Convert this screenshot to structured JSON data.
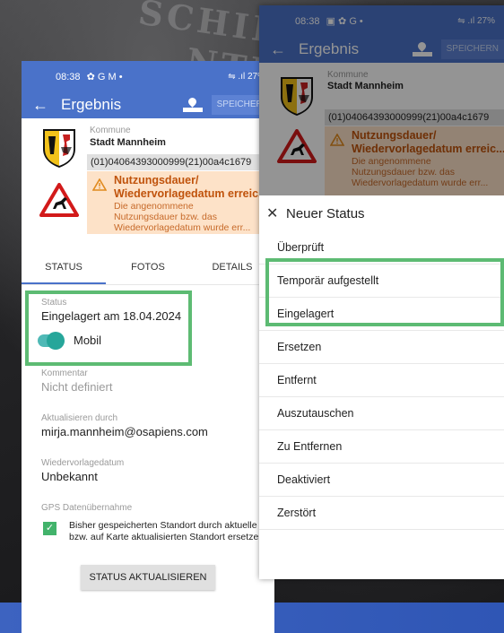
{
  "background": {
    "engraved_text": [
      "SCHILDERWE",
      "NTHA GR"
    ]
  },
  "left_phone": {
    "status_bar": {
      "time": "08:38",
      "icons": "✿ G M •",
      "battery": "27%"
    },
    "app_bar": {
      "title": "Ergebnis",
      "save_label": "SPEICHERN"
    },
    "object": {
      "kommune_label": "Kommune",
      "kommune_value": "Stadt Mannheim",
      "code": "(01)04064393000999(21)00a4c1679",
      "warning_title_1": "Nutzungsdauer/",
      "warning_title_2": "Wiedervorlagedatum erreic...",
      "warning_text_1": "Die angenommene",
      "warning_text_2": "Nutzungsdauer bzw. das",
      "warning_text_3": "Wiedervorlagedatum wurde err..."
    },
    "tabs": [
      "STATUS",
      "FOTOS",
      "DETAILS"
    ],
    "status": {
      "label": "Status",
      "value": "Eingelagert am 18.04.2024",
      "toggle_label": "Mobil",
      "toggle_on": true
    },
    "kommentar": {
      "label": "Kommentar",
      "value": "Nicht definiert"
    },
    "aktualisiert": {
      "label": "Aktualisieren durch",
      "value": "mirja.mannheim@osapiens.com"
    },
    "wiedervorlage": {
      "label": "Wiedervorlagedatum",
      "value": "Unbekannt"
    },
    "gps": {
      "label": "GPS Datenübernahme",
      "text_1": "Bisher gespeicherten Standort durch aktuelle",
      "text_2": "bzw. auf Karte aktualisierten Standort ersetzen",
      "checked": true
    },
    "update_button": "STATUS AKTUALISIEREN"
  },
  "right_phone": {
    "status_bar": {
      "time": "08:38",
      "icons": "▣ ✿ G •",
      "battery": "27%"
    },
    "app_bar": {
      "title": "Ergebnis",
      "save_label": "SPEICHERN"
    },
    "object": {
      "kommune_label": "Kommune",
      "kommune_value": "Stadt Mannheim",
      "code": "(01)04064393000999(21)00a4c1679",
      "warning_title_1": "Nutzungsdauer/",
      "warning_title_2": "Wiedervorlagedatum erreic...",
      "warning_text_1": "Die angenommene",
      "warning_text_2": "Nutzungsdauer bzw. das",
      "warning_text_3": "Wiedervorlagedatum wurde err..."
    },
    "sheet": {
      "title": "Neuer Status",
      "items": [
        "Überprüft",
        "Temporär aufgestellt",
        "Eingelagert",
        "Ersetzen",
        "Entfernt",
        "Auszutauschen",
        "Zu Entfernen",
        "Deaktiviert",
        "Zerstört"
      ]
    }
  },
  "colors": {
    "primary": "#4a72c9",
    "highlight": "#5dbb73",
    "warning_bg": "#fde2c8",
    "warning_text": "#c0530c",
    "toggle": "#26a69a"
  }
}
